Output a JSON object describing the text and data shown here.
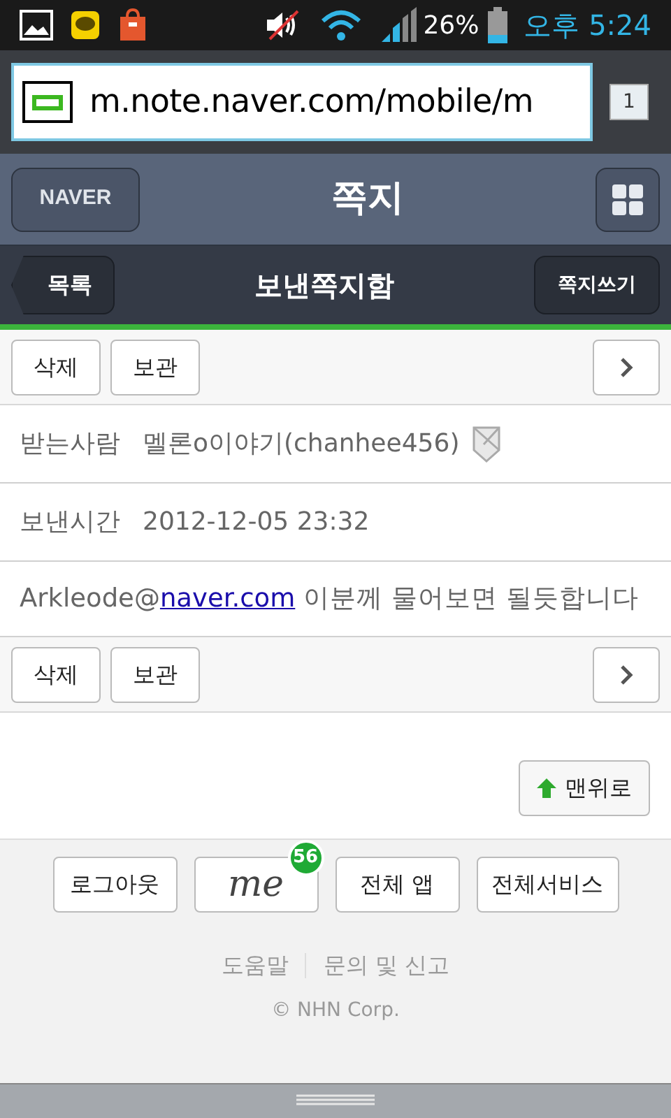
{
  "status_bar": {
    "battery": "26%",
    "time": "오후 5:24"
  },
  "address_bar": {
    "url": "m.note.naver.com/mobile/m",
    "tab_count": "1"
  },
  "header": {
    "logo": "NAVER",
    "title": "쪽지"
  },
  "subheader": {
    "back": "목록",
    "title": "보낸쪽지함",
    "compose": "쪽지쓰기"
  },
  "toolbars": [
    {
      "buttons": [
        "삭제",
        "보관"
      ]
    },
    {
      "buttons": [
        "삭제",
        "보관"
      ]
    }
  ],
  "message": {
    "fields": [
      {
        "label": "받는사람",
        "value": "멜론o이야기(chanhee456)"
      },
      {
        "label": "보낸시간",
        "value": "2012-12-05 23:32"
      }
    ],
    "body_before": "Arkleode@",
    "body_link": "naver.com",
    "body_after": " 이분께 물어보면 될듯합니다"
  },
  "top_button": "맨위로",
  "footer": {
    "buttons": [
      {
        "kind": "text",
        "label": "로그아웃"
      },
      {
        "kind": "me",
        "label": "me",
        "badge": "56"
      },
      {
        "kind": "text",
        "label": "전체 앱"
      },
      {
        "kind": "text",
        "label": "전체서비스"
      }
    ],
    "links": [
      "도움말",
      "문의 및 신고"
    ],
    "copyright": "© NHN Corp."
  }
}
